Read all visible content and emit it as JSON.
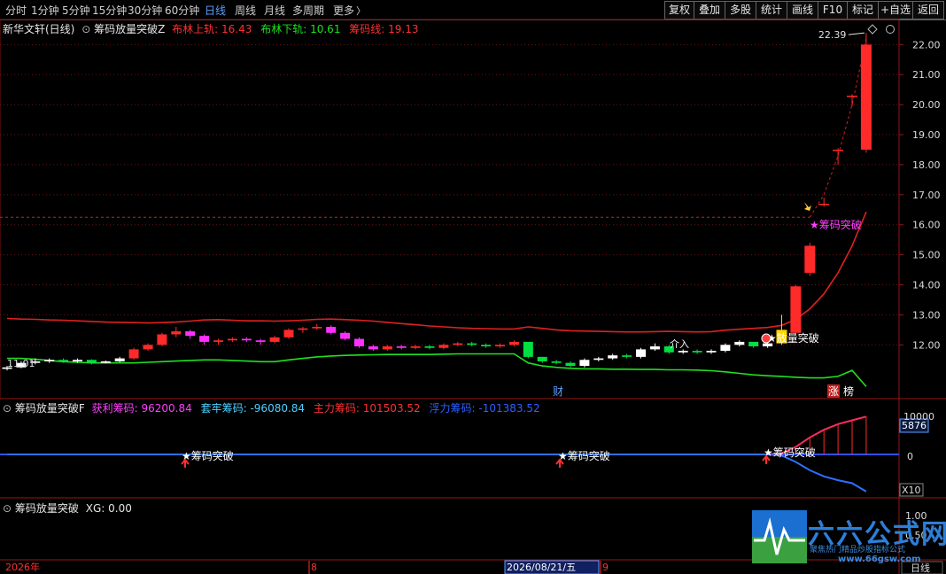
{
  "toolbar": {
    "periods": [
      "分时",
      "1分钟",
      "5分钟",
      "15分钟",
      "30分钟",
      "60分钟",
      "日线",
      "周线",
      "月线",
      "多周期",
      "更多"
    ],
    "active_period": "日线",
    "more_arrow": "〉",
    "actions": [
      "复权",
      "叠加",
      "多股",
      "统计",
      "画线",
      "F10",
      "标记",
      "+自选",
      "返回"
    ]
  },
  "main_panel": {
    "stock_title": "新华文轩(日线)",
    "indicator_name": "筹码放量突破Z",
    "bb_upper_label": "布林上轨:",
    "bb_upper_value": "16.43",
    "bb_lower_label": "布林下轨:",
    "bb_lower_value": "10.61",
    "chip_label": "筹码线:",
    "chip_value": "19.13",
    "high_marker": "22.39",
    "low_marker": "11.01",
    "annotation_chip_breakout": "★筹码突破",
    "annotation_volume_breakout": "★放量突破",
    "annotation_jieru": "介入",
    "finance_tag": "财",
    "limit_tag": "涨",
    "list_tag": "榜",
    "y_ticks": [
      "22.00",
      "21.00",
      "20.00",
      "19.00",
      "18.00",
      "17.00",
      "16.00",
      "15.00",
      "14.00",
      "13.00",
      "12.00"
    ]
  },
  "sub_panel_1": {
    "indicator_name": "筹码放量突破F",
    "profit_label": "获利筹码:",
    "profit_value": "96200.84",
    "trapped_label": "套牢筹码:",
    "trapped_value": "-96080.84",
    "main_label": "主力筹码:",
    "main_value": "101503.52",
    "float_label": "浮力筹码:",
    "float_value": "-101383.52",
    "signal_text": "★筹码突破",
    "y_ticks": [
      "10000",
      "0"
    ],
    "current_value": "5876",
    "scale_tag": "X10"
  },
  "sub_panel_2": {
    "indicator_name": "筹码放量突破",
    "xg_label": "XG:",
    "xg_value": "0.00",
    "y_ticks": [
      "1.00",
      "0.50"
    ]
  },
  "time_axis": {
    "start_label": "2026年",
    "month_8": "8",
    "cursor_date": "2026/08/21/五",
    "month_9": "9",
    "period_tag": "日线"
  },
  "watermark": {
    "title": "六六公式网",
    "subtitle": "聚焦热门精品炒股指标公式",
    "url": "www.66gsw.com"
  },
  "colors": {
    "up": "#ff2a2a",
    "down": "#00e040",
    "bb_upper": "#e02020",
    "bb_lower": "#20e020",
    "magenta": "#ff30ff",
    "blue_axis": "#5aa0ff"
  },
  "chart_data": {
    "type": "candlestick",
    "ylim": [
      10.8,
      22.6
    ],
    "candles": [
      [
        11.2,
        11.25,
        11.3,
        11.15
      ],
      [
        11.25,
        11.4,
        11.45,
        11.22
      ],
      [
        11.4,
        11.45,
        11.55,
        11.35
      ],
      [
        11.45,
        11.5,
        11.55,
        11.4
      ],
      [
        11.5,
        11.45,
        11.55,
        11.4
      ],
      [
        11.45,
        11.5,
        11.55,
        11.4
      ],
      [
        11.5,
        11.4,
        11.52,
        11.35
      ],
      [
        11.4,
        11.45,
        11.48,
        11.38
      ],
      [
        11.45,
        11.55,
        11.6,
        11.42
      ],
      [
        11.55,
        11.85,
        11.9,
        11.5
      ],
      [
        11.85,
        12.0,
        12.05,
        11.8
      ],
      [
        12.0,
        12.35,
        12.4,
        11.95
      ],
      [
        12.35,
        12.45,
        12.6,
        12.25
      ],
      [
        12.45,
        12.3,
        12.5,
        12.2
      ],
      [
        12.3,
        12.1,
        12.35,
        12.0
      ],
      [
        12.1,
        12.15,
        12.2,
        12.0
      ],
      [
        12.15,
        12.2,
        12.25,
        12.1
      ],
      [
        12.2,
        12.15,
        12.25,
        12.1
      ],
      [
        12.15,
        12.1,
        12.2,
        12.0
      ],
      [
        12.1,
        12.25,
        12.3,
        12.05
      ],
      [
        12.25,
        12.5,
        12.55,
        12.2
      ],
      [
        12.5,
        12.55,
        12.6,
        12.4
      ],
      [
        12.55,
        12.6,
        12.7,
        12.5
      ],
      [
        12.6,
        12.4,
        12.65,
        12.35
      ],
      [
        12.4,
        12.2,
        12.45,
        12.15
      ],
      [
        12.2,
        11.95,
        12.25,
        11.9
      ],
      [
        11.95,
        11.85,
        12.0,
        11.8
      ],
      [
        11.85,
        11.95,
        12.0,
        11.8
      ],
      [
        11.95,
        11.9,
        12.0,
        11.85
      ],
      [
        11.9,
        11.95,
        12.0,
        11.85
      ],
      [
        11.95,
        11.9,
        12.0,
        11.85
      ],
      [
        11.9,
        12.0,
        12.05,
        11.85
      ],
      [
        12.0,
        12.05,
        12.1,
        11.95
      ],
      [
        12.05,
        12.0,
        12.1,
        11.95
      ],
      [
        12.0,
        11.95,
        12.05,
        11.9
      ],
      [
        11.95,
        12.0,
        12.05,
        11.9
      ],
      [
        12.0,
        12.1,
        12.15,
        11.95
      ],
      [
        12.1,
        11.6,
        12.1,
        11.55
      ],
      [
        11.6,
        11.45,
        11.6,
        11.4
      ],
      [
        11.45,
        11.4,
        11.5,
        11.35
      ],
      [
        11.4,
        11.3,
        11.45,
        11.25
      ],
      [
        11.3,
        11.5,
        11.55,
        11.25
      ],
      [
        11.5,
        11.55,
        11.6,
        11.45
      ],
      [
        11.55,
        11.65,
        11.7,
        11.5
      ],
      [
        11.65,
        11.6,
        11.7,
        11.55
      ],
      [
        11.6,
        11.85,
        11.9,
        11.55
      ],
      [
        11.85,
        11.95,
        12.05,
        11.8
      ],
      [
        11.95,
        11.75,
        12.0,
        11.7
      ],
      [
        11.75,
        11.8,
        11.85,
        11.7
      ],
      [
        11.8,
        11.75,
        11.85,
        11.7
      ],
      [
        11.75,
        11.8,
        11.85,
        11.7
      ],
      [
        11.8,
        12.0,
        12.05,
        11.75
      ],
      [
        12.0,
        12.1,
        12.15,
        11.95
      ],
      [
        12.1,
        11.95,
        12.1,
        11.9
      ],
      [
        11.95,
        12.05,
        12.1,
        11.9
      ],
      [
        12.05,
        12.5,
        13.0,
        12.0
      ],
      [
        12.4,
        13.95,
        14.0,
        12.4
      ],
      [
        14.4,
        15.3,
        15.4,
        14.3
      ],
      [
        16.7,
        16.7,
        16.9,
        16.6
      ],
      [
        18.5,
        18.5,
        18.55,
        18.0
      ],
      [
        20.3,
        20.3,
        20.35,
        19.95
      ],
      [
        18.5,
        22.0,
        22.39,
        18.4
      ]
    ],
    "bb_upper": [
      12.88,
      12.86,
      12.85,
      12.83,
      12.82,
      12.8,
      12.78,
      12.76,
      12.75,
      12.74,
      12.73,
      12.74,
      12.76,
      12.79,
      12.83,
      12.84,
      12.82,
      12.8,
      12.8,
      12.79,
      12.8,
      12.82,
      12.85,
      12.86,
      12.84,
      12.82,
      12.79,
      12.75,
      12.71,
      12.67,
      12.63,
      12.6,
      12.57,
      12.55,
      12.54,
      12.53,
      12.53,
      12.6,
      12.55,
      12.5,
      12.47,
      12.46,
      12.45,
      12.44,
      12.43,
      12.43,
      12.44,
      12.45,
      12.44,
      12.43,
      12.44,
      12.49,
      12.52,
      12.55,
      12.58,
      12.65,
      12.85,
      13.2,
      13.7,
      14.4,
      15.3,
      16.43
    ],
    "bb_lower": [
      11.55,
      11.55,
      11.52,
      11.48,
      11.44,
      11.42,
      11.4,
      11.4,
      11.4,
      11.4,
      11.42,
      11.44,
      11.46,
      11.48,
      11.5,
      11.5,
      11.48,
      11.46,
      11.44,
      11.44,
      11.5,
      11.55,
      11.6,
      11.63,
      11.65,
      11.66,
      11.67,
      11.68,
      11.68,
      11.68,
      11.68,
      11.69,
      11.7,
      11.7,
      11.7,
      11.7,
      11.7,
      11.4,
      11.3,
      11.25,
      11.22,
      11.2,
      11.2,
      11.19,
      11.19,
      11.18,
      11.18,
      11.17,
      11.17,
      11.16,
      11.14,
      11.1,
      11.05,
      11.0,
      10.97,
      10.95,
      10.92,
      10.9,
      10.9,
      10.95,
      11.15,
      10.61
    ],
    "chip_line_level": 16.25,
    "subchart": {
      "profit": [
        0,
        0,
        0,
        0,
        0,
        0,
        0,
        0,
        0,
        0,
        0,
        0,
        0,
        0,
        0,
        0,
        0,
        0,
        0,
        0,
        0,
        0,
        0,
        0,
        0,
        0,
        0,
        0,
        0,
        0,
        0,
        0,
        0,
        0,
        0,
        0,
        0,
        0,
        0,
        0,
        0,
        0,
        0,
        0,
        0,
        0,
        0,
        0,
        0,
        0,
        0,
        0,
        0,
        0,
        0,
        300,
        2000,
        4500,
        6500,
        8000,
        9000,
        10000
      ],
      "trapped": [
        0,
        0,
        0,
        0,
        0,
        0,
        0,
        0,
        0,
        0,
        0,
        0,
        0,
        0,
        0,
        0,
        0,
        0,
        0,
        0,
        0,
        0,
        0,
        0,
        0,
        0,
        0,
        0,
        0,
        0,
        0,
        0,
        0,
        0,
        0,
        0,
        0,
        0,
        0,
        0,
        0,
        0,
        0,
        0,
        0,
        0,
        0,
        0,
        0,
        0,
        0,
        0,
        0,
        0,
        0,
        -300,
        -2000,
        -4200,
        -5800,
        -6800,
        -7600,
        -9800
      ],
      "ylim": [
        -11000,
        11000
      ]
    }
  }
}
